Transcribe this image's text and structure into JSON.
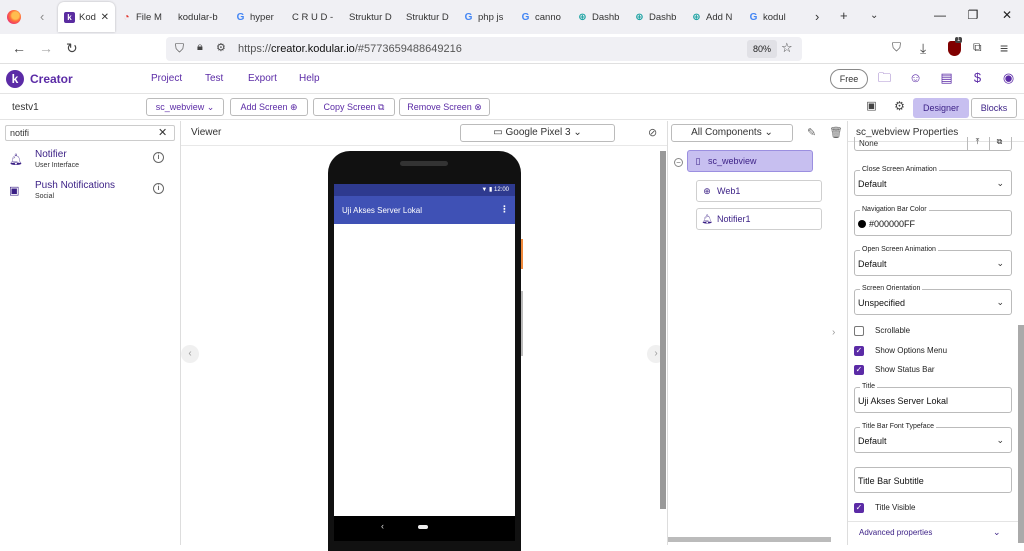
{
  "browser": {
    "tabs": [
      {
        "icon": "kodular-icon",
        "title": "Kod"
      },
      {
        "icon": "file-manager-icon",
        "title": "File M"
      },
      {
        "icon": "blank-icon",
        "title": "kodular-b"
      },
      {
        "icon": "google-icon",
        "title": "hyper"
      },
      {
        "icon": "blank-icon",
        "title": "C R U D -"
      },
      {
        "icon": "blank-icon",
        "title": "Struktur D"
      },
      {
        "icon": "blank-icon",
        "title": "Struktur D"
      },
      {
        "icon": "google-icon",
        "title": "php js"
      },
      {
        "icon": "google-icon",
        "title": "canno"
      },
      {
        "icon": "globe-icon",
        "title": "Dashb"
      },
      {
        "icon": "globe-icon",
        "title": "Dashb"
      },
      {
        "icon": "globe-icon",
        "title": "Add N"
      },
      {
        "icon": "google-icon",
        "title": "kodul"
      }
    ],
    "url_prefix": "https://",
    "url_host": "creator.kodular.io",
    "url_path": "/#5773659488649216",
    "zoom": "80%",
    "ublock_count": "1"
  },
  "app": {
    "brand": "Creator",
    "menu": [
      "Project",
      "Test",
      "Export",
      "Help"
    ],
    "free_label": "Free"
  },
  "project": {
    "name": "testv1",
    "screen_select": "sc_webview",
    "add_screen": "Add Screen",
    "copy_screen": "Copy Screen",
    "remove_screen": "Remove Screen",
    "designer": "Designer",
    "blocks": "Blocks"
  },
  "palette": {
    "search_value": "notifi",
    "items": [
      {
        "name": "Notifier",
        "category": "User Interface",
        "icon": "bell-icon"
      },
      {
        "name": "Push Notifications",
        "category": "Social",
        "icon": "push-notification-icon"
      }
    ]
  },
  "viewer": {
    "label": "Viewer",
    "device": "Google Pixel 3",
    "status_time": "12:00",
    "app_title": "Uji Akses Server Lokal"
  },
  "tree": {
    "filter": "All Components",
    "root": "sc_webview",
    "children": [
      {
        "name": "Web1",
        "icon": "globe-icon"
      },
      {
        "name": "Notifier1",
        "icon": "bell-icon"
      }
    ]
  },
  "properties": {
    "title": "sc_webview Properties",
    "partial_value": "None",
    "close_anim_label": "Close Screen Animation",
    "close_anim_value": "Default",
    "navbar_color_label": "Navigation Bar Color",
    "navbar_color_value": "#000000FF",
    "open_anim_label": "Open Screen Animation",
    "open_anim_value": "Default",
    "orientation_label": "Screen Orientation",
    "orientation_value": "Unspecified",
    "scrollable": "Scrollable",
    "show_options_menu": "Show Options Menu",
    "show_status_bar": "Show Status Bar",
    "title_label": "Title",
    "title_value": "Uji Akses Server Lokal",
    "typeface_label": "Title Bar Font Typeface",
    "typeface_value": "Default",
    "subtitle_placeholder": "Title Bar Subtitle",
    "title_visible": "Title Visible",
    "advanced": "Advanced properties"
  }
}
